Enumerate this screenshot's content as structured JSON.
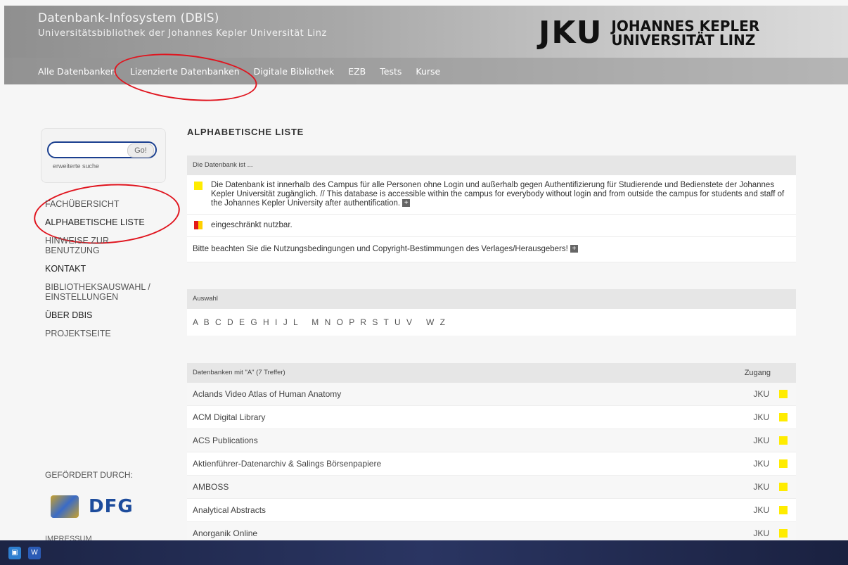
{
  "header": {
    "title": "Datenbank-Infosystem (DBIS)",
    "subtitle": "Universitätsbibliothek der Johannes Kepler Universität Linz",
    "logo_mark": "JKU",
    "logo_line1": "JOHANNES KEPLER",
    "logo_line2": "UNIVERSITÄT LINZ"
  },
  "nav": {
    "items": [
      {
        "label": "Alle Datenbanken"
      },
      {
        "label": "Lizenzierte Datenbanken"
      },
      {
        "label": "Digitale Bibliothek"
      },
      {
        "label": "EZB"
      },
      {
        "label": "Tests"
      },
      {
        "label": "Kurse"
      }
    ]
  },
  "search": {
    "value": "",
    "go_label": "Go!",
    "advanced_label": "erweiterte suche"
  },
  "sidebar": {
    "items": [
      {
        "label": "FACHÜBERSICHT"
      },
      {
        "label": "ALPHABETISCHE LISTE"
      },
      {
        "label": "HINWEISE ZUR BENUTZUNG"
      },
      {
        "label": "KONTAKT"
      },
      {
        "label": "BIBLIOTHEKSAUSWAHL / EINSTELLUNGEN"
      },
      {
        "label": "ÜBER DBIS"
      },
      {
        "label": "PROJEKTSEITE"
      }
    ],
    "funded_label": "GEFÖRDERT DURCH:",
    "dfg_label": "DFG",
    "impressum_label": "IMPRESSUM"
  },
  "main": {
    "title": "ALPHABETISCHE LISTE",
    "legend": {
      "header": "Die Datenbank ist ...",
      "free_text": "Die Datenbank ist innerhalb des Campus für alle Personen ohne Login und außerhalb gegen Authentifizierung für Studierende und Bedienstete der Johannes Kepler Universität zugänglich. // This database is accessible within the campus for everybody without login and from outside the campus for students and staff of the Johannes Kepler University after authentification.",
      "restricted_text": "eingeschränkt nutzbar.",
      "terms_text": "Bitte beachten Sie die Nutzungsbedingungen und Copyright-Bestimmungen des Verlages/Herausgebers!"
    },
    "selection": {
      "header": "Auswahl",
      "letters": "A B C D E G H I J L   M N O P R S T U V   W Z"
    },
    "results": {
      "header": "Datenbanken mit \"A\" (7 Treffer)",
      "access_header": "Zugang",
      "rows": [
        {
          "name": "Aclands Video Atlas of Human Anatomy",
          "access": "JKU"
        },
        {
          "name": "ACM Digital Library",
          "access": "JKU"
        },
        {
          "name": "ACS Publications",
          "access": "JKU"
        },
        {
          "name": "Aktienführer-Datenarchiv & Salings Börsenpapiere",
          "access": "JKU"
        },
        {
          "name": "AMBOSS",
          "access": "JKU"
        },
        {
          "name": "Analytical Abstracts",
          "access": "JKU"
        },
        {
          "name": "Anorganik Online",
          "access": "JKU"
        }
      ]
    }
  },
  "colors": {
    "annotation_red": "#e0141e",
    "access_yellow": "#ffec00",
    "search_border": "#1a3f8f"
  }
}
